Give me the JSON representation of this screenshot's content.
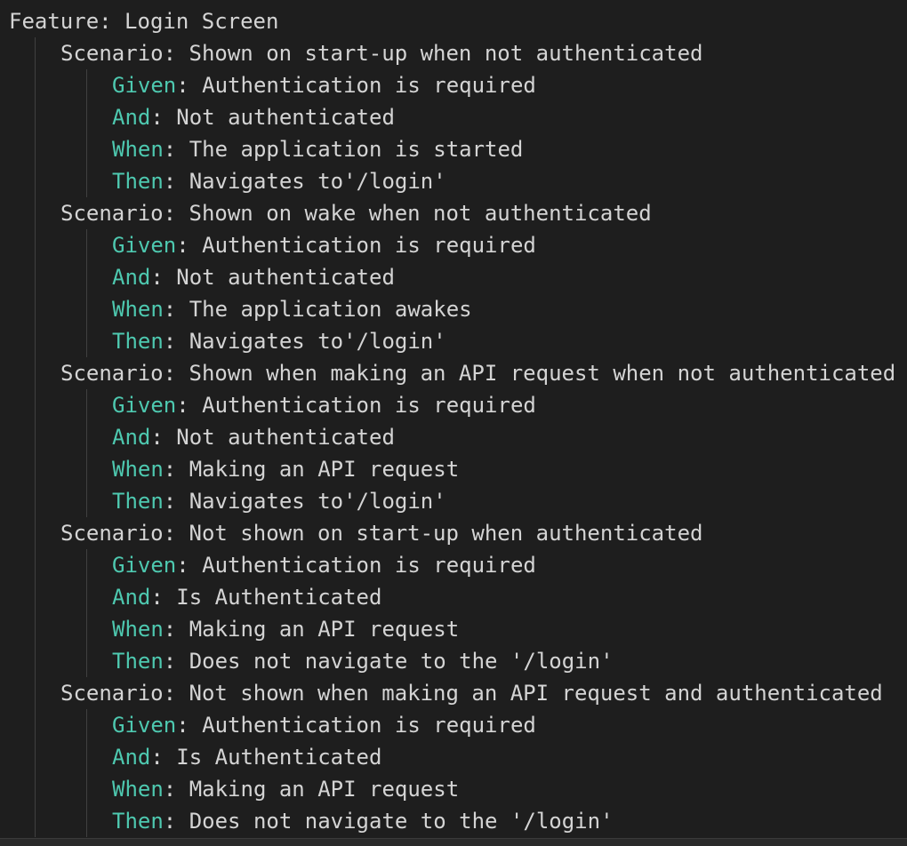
{
  "feature": {
    "keyword": "Feature:",
    "title": "Login Screen"
  },
  "colors": {
    "background": "#1e1e1e",
    "text": "#d4d4d4",
    "step_keyword": "#4ec9b0",
    "indent_guide": "#404040"
  },
  "scenarios": [
    {
      "keyword": "Scenario:",
      "title": "Shown on start-up when not authenticated",
      "steps": [
        {
          "keyword": "Given",
          "text": "Authentication is required"
        },
        {
          "keyword": "And",
          "text": "Not authenticated"
        },
        {
          "keyword": "When",
          "text": "The application is started"
        },
        {
          "keyword": "Then",
          "text": "Navigates to'/login'"
        }
      ]
    },
    {
      "keyword": "Scenario:",
      "title": "Shown on wake when not authenticated",
      "steps": [
        {
          "keyword": "Given",
          "text": "Authentication is required"
        },
        {
          "keyword": "And",
          "text": "Not authenticated"
        },
        {
          "keyword": "When",
          "text": "The application awakes"
        },
        {
          "keyword": "Then",
          "text": "Navigates to'/login'"
        }
      ]
    },
    {
      "keyword": "Scenario:",
      "title": "Shown when making an API request when not authenticated",
      "steps": [
        {
          "keyword": "Given",
          "text": "Authentication is required"
        },
        {
          "keyword": "And",
          "text": "Not authenticated"
        },
        {
          "keyword": "When",
          "text": "Making an API request"
        },
        {
          "keyword": "Then",
          "text": "Navigates to'/login'"
        }
      ]
    },
    {
      "keyword": "Scenario:",
      "title": "Not shown on start-up when authenticated",
      "steps": [
        {
          "keyword": "Given",
          "text": "Authentication is required"
        },
        {
          "keyword": "And",
          "text": "Is Authenticated"
        },
        {
          "keyword": "When",
          "text": "Making an API request"
        },
        {
          "keyword": "Then",
          "text": "Does not navigate to the '/login'"
        }
      ]
    },
    {
      "keyword": "Scenario:",
      "title": "Not shown when making an API request and authenticated",
      "steps": [
        {
          "keyword": "Given",
          "text": "Authentication is required"
        },
        {
          "keyword": "And",
          "text": "Is Authenticated"
        },
        {
          "keyword": "When",
          "text": "Making an API request"
        },
        {
          "keyword": "Then",
          "text": "Does not navigate to the '/login'"
        }
      ]
    }
  ]
}
